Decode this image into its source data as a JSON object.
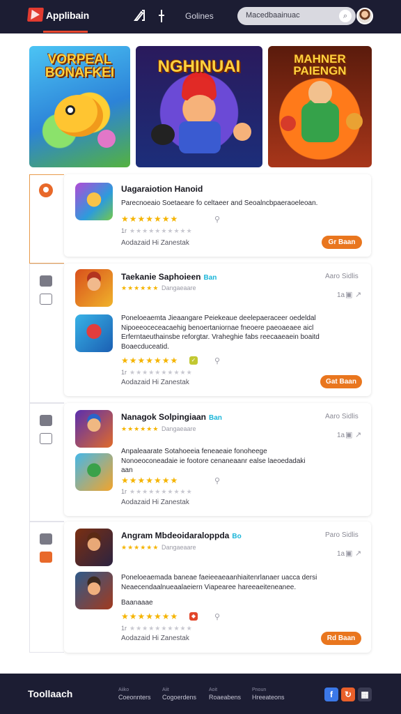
{
  "header": {
    "brand": "Applibain",
    "nav_link": "Golines",
    "search_placeholder": "Macedbaainuac",
    "icons": [
      "app-logo-icon",
      "chart-icon",
      "pin-icon",
      "search-icon",
      "user-avatar"
    ]
  },
  "banners": [
    {
      "title": "VORPEAL BONAFKEI"
    },
    {
      "title": "NGHINUAI"
    },
    {
      "title": "MAHNER PAIENGN"
    }
  ],
  "cards": [
    {
      "title": "Uagaraiotion Hanoid",
      "description": "Parecnoeaio Soetaeare fo celtaeer and Seoalncbpaeraoeleoan.",
      "sub_stars": "1r",
      "meta": "Aodazaid Hi  Zanestak",
      "button": "Gr Baan"
    },
    {
      "title": "Taekanie Saphoieen",
      "badge": "Ban",
      "right_label": "Aaro Sidlis",
      "stat": "1a",
      "star_caption": "Dangaeaare",
      "description": "Poneloeaemta Jieaangare Peiekeaue deelepaeraceer oedeldal Nipoeeoceceacaehig benoertaniornae fneoere paeoaeaee aicl Erferntaeuthainsbe reforgtar. Vraheghie fabs reecaaeaein boaitd Boaecduceatid.",
      "sub_stars": "1r",
      "meta": "Aodazaid Hi  Zanestak",
      "button": "Gat Baan"
    },
    {
      "title": "Nanagok Solpingiaan",
      "badge": "Ban",
      "right_label": "Aaro Sidlis",
      "stat": "1a",
      "star_caption": "Dangaeaare",
      "description": "Anpaleaarate Sotahoeeia feneaeaie fonoheege Nonoeoconeadaie ie footore cenaneaanr ealse laeoedadaki aan",
      "sub_stars": "1r",
      "meta": "Aodazaid Hi  Zanestak",
      "button": ""
    },
    {
      "title": "Angram Mbdeoidaraloppda",
      "badge": "Bo",
      "right_label": "Paro Sidlis",
      "stat": "1a",
      "star_caption": "Dangaeaare",
      "description": "Poneloeaemada baneae faeieeaeaanhiaitenrlanaer uacca dersi Neaecendaalnueaalaeiern Viapearee hareeaeiteneanee.",
      "extra": "Baanaaae",
      "sub_stars": "1r",
      "meta": "Aodazaid Hi  Zanestak",
      "button": "Rd Baan"
    }
  ],
  "footer": {
    "brand": "Toollaach",
    "columns": [
      {
        "caption": "Aiiko",
        "label": "Coeonnters"
      },
      {
        "caption": "Aiit",
        "label": "Cogoerdens"
      },
      {
        "caption": "Aoit",
        "label": "Roaeabens"
      },
      {
        "caption": "Pnoun",
        "label": "Hreeateons"
      }
    ],
    "social": [
      {
        "name": "facebook-icon",
        "glyph": "f",
        "color": "#3b78e7"
      },
      {
        "name": "share-icon",
        "glyph": "↻",
        "color": "#e9602a"
      },
      {
        "name": "grid-icon",
        "glyph": "▦",
        "color": "#3a3b52"
      }
    ]
  }
}
